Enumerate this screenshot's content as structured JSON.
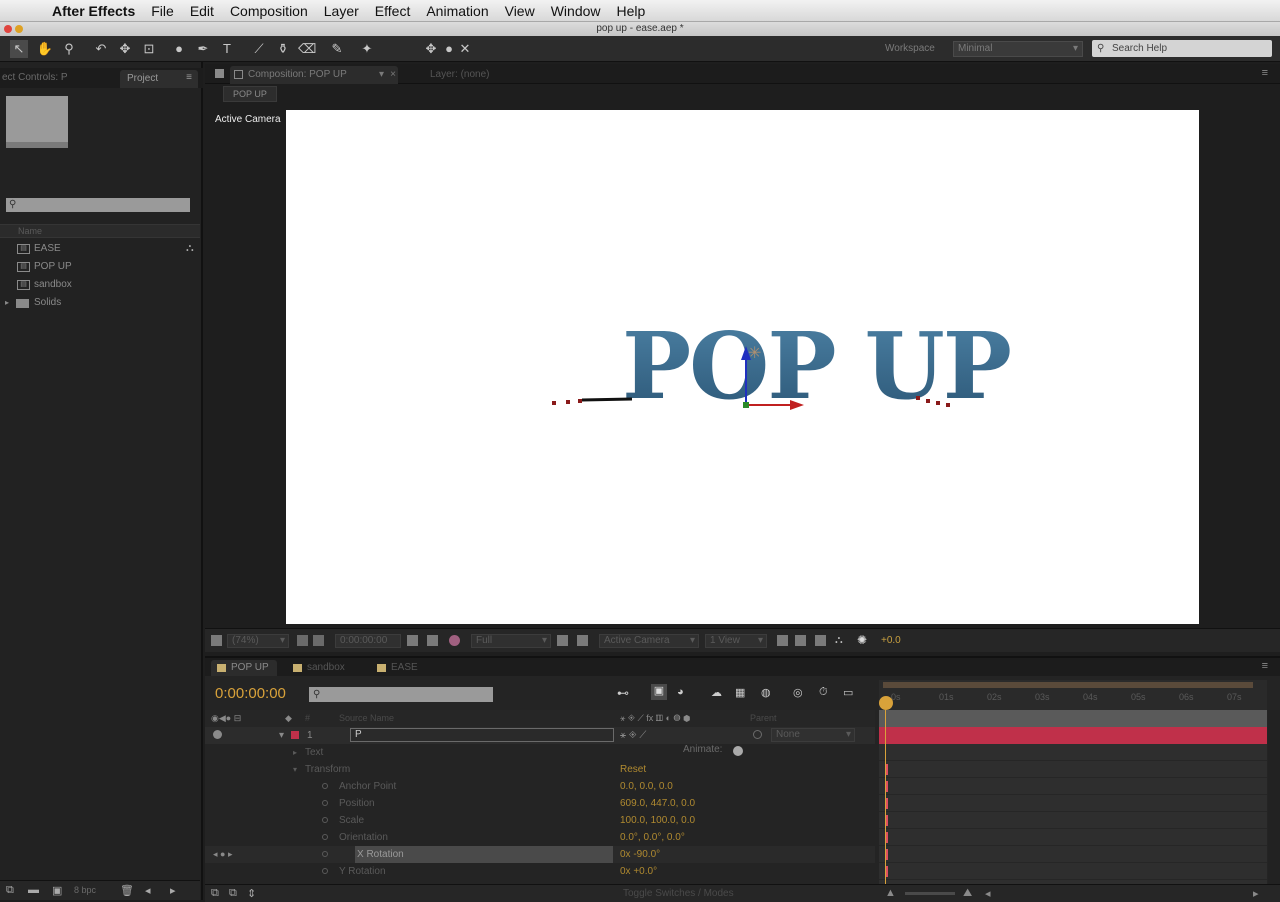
{
  "menubar": {
    "app_name": "After Effects",
    "items": [
      "File",
      "Edit",
      "Composition",
      "Layer",
      "Effect",
      "Animation",
      "View",
      "Window",
      "Help"
    ]
  },
  "window": {
    "title": "pop up - ease.aep *"
  },
  "toolbar": {
    "workspace_label": "Workspace",
    "workspace_value": "Minimal",
    "search_placeholder": "Search Help"
  },
  "project_panel": {
    "effect_controls_tab": "ect Controls: P",
    "project_tab": "Project",
    "name_header": "Name",
    "items": [
      {
        "label": "EASE",
        "icon": "composition-icon"
      },
      {
        "label": "POP UP",
        "icon": "composition-icon"
      },
      {
        "label": "sandbox",
        "icon": "composition-icon"
      },
      {
        "label": "Solids",
        "icon": "folder-icon"
      }
    ],
    "bpc": "8 bpc"
  },
  "composition_panel": {
    "tab_label": "Composition: POP UP",
    "layer_tab": "Layer: (none)",
    "breadcrumb": "POP UP",
    "view_label": "Active Camera",
    "canvas_text": "POP UP",
    "canvas_text_color": "#3e6f92",
    "viewer_bar": {
      "zoom": "(74%)",
      "timecode": "0:00:00:00",
      "resolution": "Full",
      "camera": "Active Camera",
      "views": "1 View",
      "exposure": "+0.0"
    }
  },
  "timeline": {
    "tabs": [
      {
        "label": "POP UP",
        "color": "#c8b070"
      },
      {
        "label": "sandbox",
        "color": "#c8b070"
      },
      {
        "label": "EASE",
        "color": "#c8b070"
      }
    ],
    "timecode": "0:00:00:00",
    "column_source_name": "Source Name",
    "column_parent": "Parent",
    "ruler_labels": [
      "0s",
      "01s",
      "02s",
      "03s",
      "04s",
      "05s",
      "06s",
      "07s"
    ],
    "layer": {
      "number": "1",
      "name": "P",
      "parent": "None",
      "color": "#c0304a"
    },
    "properties": [
      {
        "name": "Text",
        "value": "",
        "indent": 1,
        "twirl": "▸",
        "stopwatch": false
      },
      {
        "name": "Transform",
        "value": "Reset",
        "indent": 1,
        "twirl": "▾",
        "stopwatch": false
      },
      {
        "name": "Anchor Point",
        "value": "0.0, 0.0, 0.0",
        "indent": 2,
        "twirl": "",
        "stopwatch": true
      },
      {
        "name": "Position",
        "value": "609.0, 447.0, 0.0",
        "indent": 2,
        "twirl": "",
        "stopwatch": true
      },
      {
        "name": "Scale",
        "value": "100.0, 100.0, 0.0",
        "indent": 2,
        "twirl": "",
        "stopwatch": true
      },
      {
        "name": "Orientation",
        "value": "0.0°, 0.0°, 0.0°",
        "indent": 2,
        "twirl": "",
        "stopwatch": true
      },
      {
        "name": "X Rotation",
        "value": "0x -90.0°",
        "indent": 2,
        "twirl": "",
        "stopwatch": true
      },
      {
        "name": "Y Rotation",
        "value": "0x +0.0°",
        "indent": 2,
        "twirl": "",
        "stopwatch": true
      }
    ],
    "animate_label": "Animate:",
    "toggle_label": "Toggle Switches / Modes"
  }
}
